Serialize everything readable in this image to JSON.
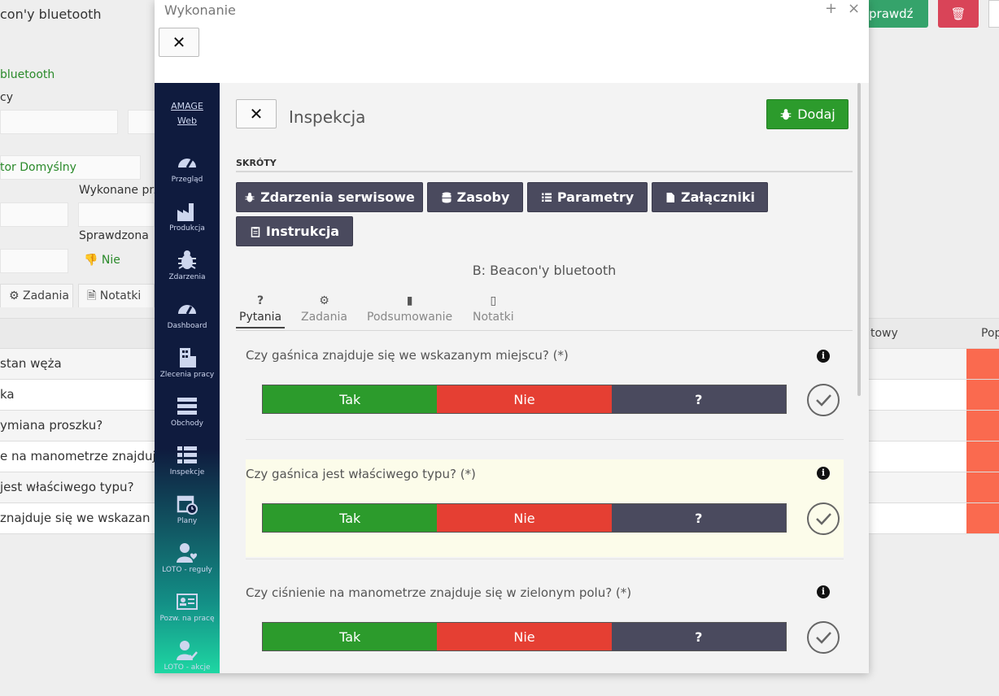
{
  "background": {
    "title": "con'y bluetooth",
    "check_button": "prawdź",
    "delete_icon": "trash-icon",
    "asset_link": "bluetooth",
    "label_cy": "cy",
    "contractor": "tor Domyślny",
    "performed_by_label": "Wykonane prz",
    "verified_label": "Sprawdzona",
    "verified_value": "Nie",
    "tabs": [
      "Zadania",
      "Notatki"
    ],
    "col_towy": "towy",
    "col_pop": "Pop",
    "rows": [
      "stan węża",
      "ka",
      "ymiana proszku?",
      "e na manometrze znajduj",
      "jest właściwego typu?",
      "znajduje się we wskazan"
    ]
  },
  "modal": {
    "title": "Wykonanie",
    "maximize": "+",
    "close": "×",
    "close_button": "✕"
  },
  "sidebar": {
    "brand": [
      "AMAGE",
      "Web"
    ],
    "items": [
      {
        "label": "Przegląd",
        "icon": "gauge-icon"
      },
      {
        "label": "Produkcja",
        "icon": "factory-icon"
      },
      {
        "label": "Zdarzenia",
        "icon": "bug-icon"
      },
      {
        "label": "Dashboard",
        "icon": "dashboard-icon"
      },
      {
        "label": "Zlecenia pracy",
        "icon": "building-icon"
      },
      {
        "label": "Obchody",
        "icon": "list-icon"
      },
      {
        "label": "Inspekcje",
        "icon": "checklist-icon"
      },
      {
        "label": "Plany",
        "icon": "calendar-icon"
      },
      {
        "label": "LOTO - reguły",
        "icon": "user-heart-icon"
      },
      {
        "label": "Pozw. na pracę",
        "icon": "id-card-icon"
      },
      {
        "label": "LOTO - akcje",
        "icon": "user-check-icon"
      }
    ]
  },
  "inspection": {
    "close_button": "✕",
    "title": "Inspekcja",
    "add_button": "Dodaj",
    "shortcuts_label": "SKRÓTY",
    "shortcuts": [
      {
        "label": "Zdarzenia serwisowe",
        "icon": "bug-icon"
      },
      {
        "label": "Zasoby",
        "icon": "database-icon"
      },
      {
        "label": "Parametry",
        "icon": "list-icon"
      },
      {
        "label": "Załączniki",
        "icon": "file-icon"
      },
      {
        "label": "Instrukcja",
        "icon": "clipboard-icon"
      }
    ],
    "asset": "B: Beacon'y bluetooth",
    "tabs": [
      {
        "label": "Pytania",
        "icon": "?",
        "active": true
      },
      {
        "label": "Zadania",
        "icon": "⚙",
        "active": false
      },
      {
        "label": "Podsumowanie",
        "icon": "▮",
        "active": false
      },
      {
        "label": "Notatki",
        "icon": "▯",
        "active": false
      }
    ],
    "questions": [
      {
        "text": "Czy gaśnica znajduje się we wskazanym miejscu? (*)",
        "highlight": false
      },
      {
        "text": "Czy gaśnica jest właściwego typu? (*)",
        "highlight": true
      },
      {
        "text": "Czy ciśnienie na manometrze znajduje się w zielonym polu? (*)",
        "highlight": false
      }
    ],
    "answers": {
      "yes": "Tak",
      "no": "Nie",
      "unknown": "?"
    },
    "info_symbol": "i"
  },
  "colors": {
    "green": "#2c9b2c",
    "red": "#e53f33",
    "dark": "#4a4a5e",
    "sidebar_top": "#0f1b3e",
    "sidebar_bottom": "#1ed7a3"
  }
}
